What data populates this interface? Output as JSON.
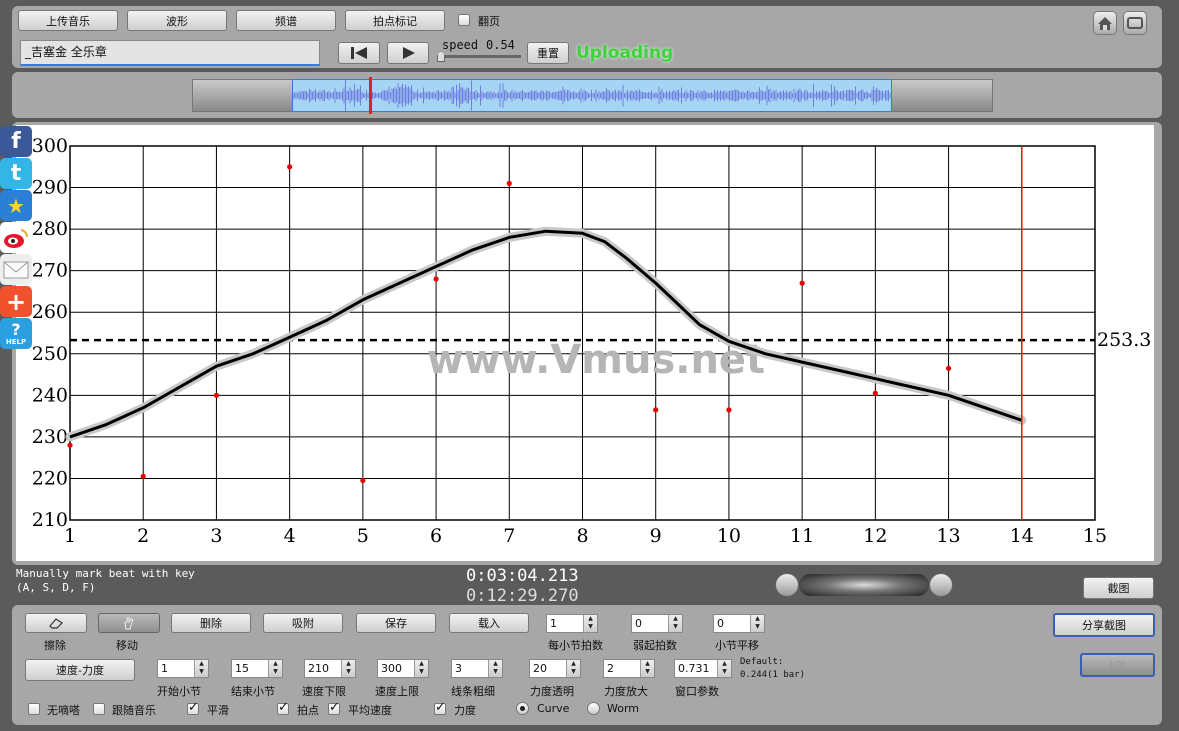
{
  "toolbar": {
    "upload_label": "上传音乐",
    "waveform_label": "波形",
    "spectrum_label": "频谱",
    "beat_mark_label": "拍点标记",
    "page_turn_label": "翻页",
    "song_title": "_吉塞金 全乐章",
    "speed_label": "speed",
    "speed_value": "0.54",
    "reset_label": "重置",
    "status": "Uploading"
  },
  "watermark": "www.Vmus.net",
  "chart_data": {
    "type": "line",
    "x_ticks": [
      "1",
      "2",
      "3",
      "4",
      "5",
      "6",
      "7",
      "8",
      "9",
      "10",
      "11",
      "12",
      "13",
      "14",
      "15"
    ],
    "y_ticks": [
      "300",
      "290",
      "280",
      "270",
      "260",
      "250",
      "240",
      "230",
      "220",
      "210"
    ],
    "xlim": [
      1,
      15
    ],
    "ylim": [
      210,
      300
    ],
    "grid": true,
    "average_value": 253.3,
    "average_label": "253.3",
    "cursor_x": 14,
    "curve": {
      "x": [
        1,
        1.5,
        2,
        2.5,
        3,
        3.5,
        4,
        4.5,
        5,
        5.5,
        6,
        6.5,
        7,
        7.5,
        8,
        8.3,
        8.6,
        9,
        9.3,
        9.6,
        10,
        10.5,
        11,
        11.5,
        12,
        12.5,
        13,
        13.5,
        14
      ],
      "y": [
        230,
        233,
        237,
        242,
        247,
        250,
        254,
        258,
        263,
        267,
        271,
        275,
        278,
        279.5,
        279,
        277,
        273,
        267,
        262,
        257,
        253,
        250,
        248,
        246,
        244,
        242,
        240,
        237,
        234
      ]
    },
    "points": {
      "x": [
        1,
        2,
        3,
        4,
        5,
        6,
        7,
        9,
        10,
        11,
        12,
        13
      ],
      "y": [
        228,
        220.5,
        240,
        295,
        219.5,
        268,
        291,
        236.5,
        236.5,
        267,
        240.5,
        246.5
      ]
    }
  },
  "info": {
    "hint_line1": "Manually mark beat with key",
    "hint_line2": "(A, S, D, F)",
    "time_current": "0:03:04.213",
    "time_total": "0:12:29.270",
    "screenshot_label": "截图"
  },
  "controls": {
    "erase_label": "擦除",
    "move_label": "移动",
    "delete_label": "删除",
    "snap_label": "吸附",
    "save_label": "保存",
    "load_label": "载入",
    "beats_per_bar_label": "每小节拍数",
    "beats_per_bar_value": "1",
    "upbeat_label": "弱起拍数",
    "upbeat_value": "0",
    "bar_shift_label": "小节平移",
    "bar_shift_value": "0",
    "share_label": "分享截图",
    "ioi_label": "IOI",
    "tempo_dynamics_label": "速度-力度",
    "start_bar_label": "开始小节",
    "start_bar_value": "1",
    "end_bar_label": "结束小节",
    "end_bar_value": "15",
    "tempo_min_label": "速度下限",
    "tempo_min_value": "210",
    "tempo_max_label": "速度上限",
    "tempo_max_value": "300",
    "line_width_label": "线条粗细",
    "line_width_value": "3",
    "dyn_alpha_label": "力度透明",
    "dyn_alpha_value": "20",
    "dyn_scale_label": "力度放大",
    "dyn_scale_value": "2",
    "window_label": "窗口参数",
    "window_value": "0.731",
    "default_line1": "Default:",
    "default_line2": "0.244(1 bar)",
    "no_click_label": "无嘀嗒",
    "follow_music_label": "跟随音乐",
    "smooth_label": "平滑",
    "beat_points_label": "拍点",
    "avg_speed_label": "平均速度",
    "dynamics_label": "力度",
    "curve_label": "Curve",
    "worm_label": "Worm"
  },
  "social": {
    "facebook": "f",
    "twitter": "t",
    "help": "HELP"
  }
}
